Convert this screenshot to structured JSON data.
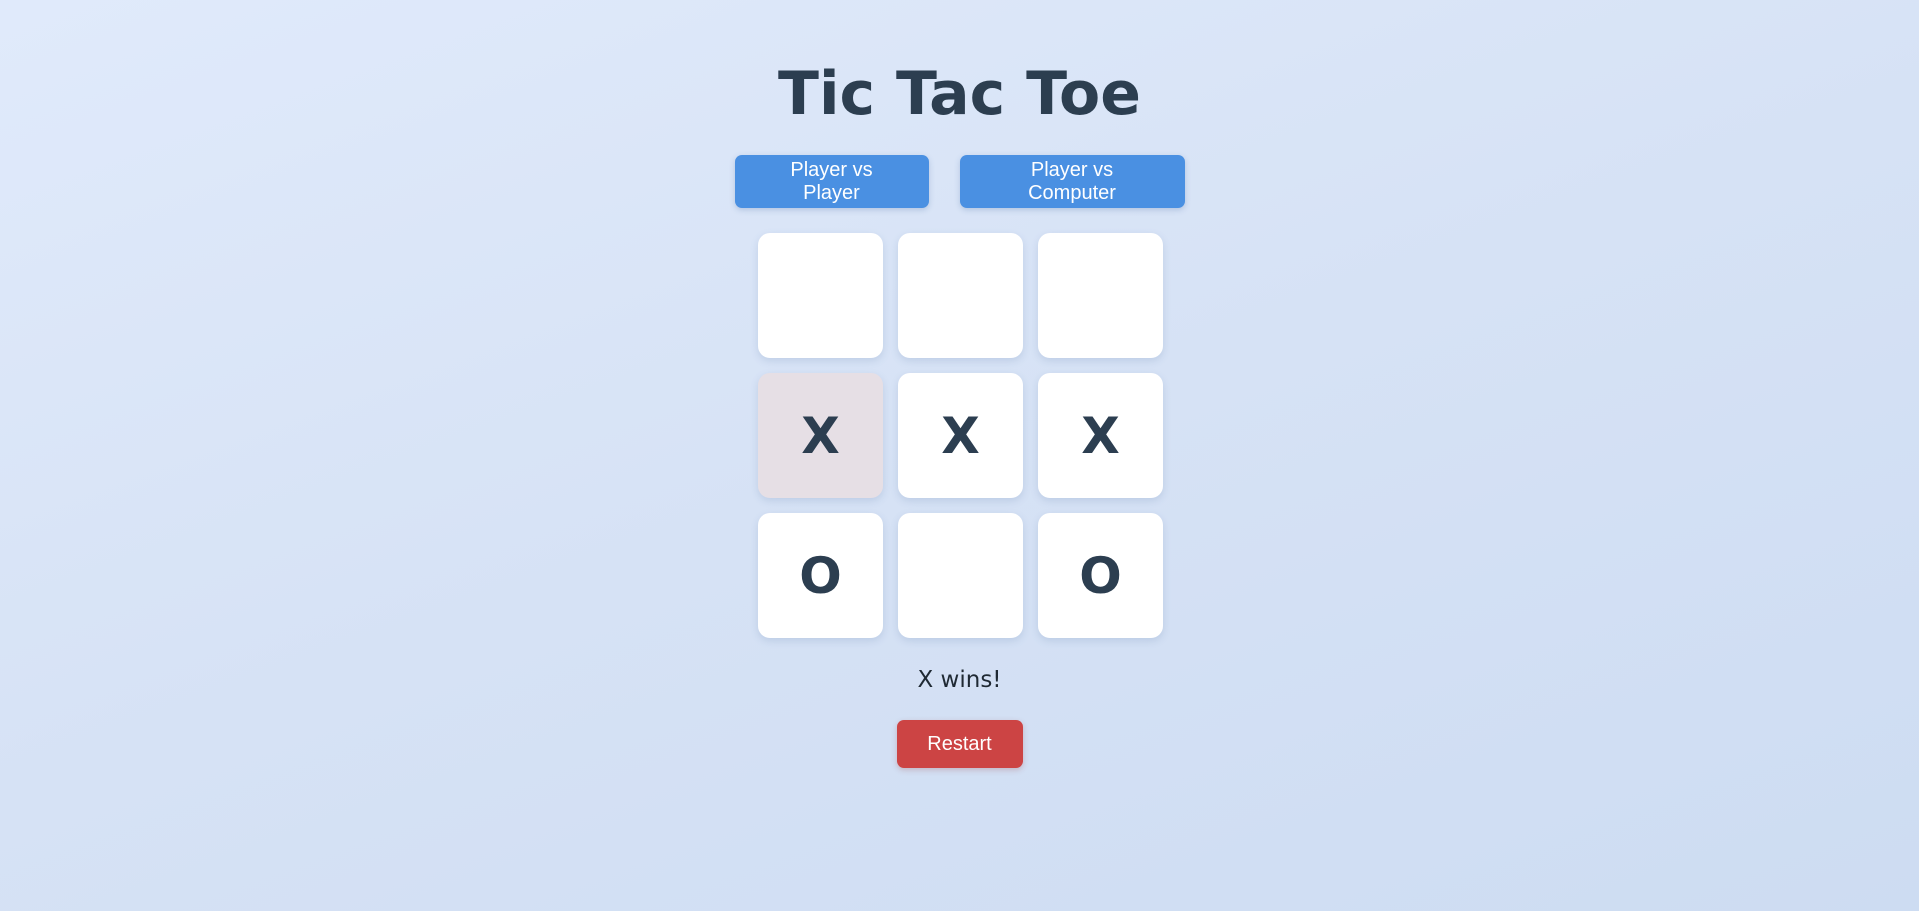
{
  "title": "Tic Tac Toe",
  "modes": {
    "pvp_label": "Player vs Player",
    "pvc_label": "Player vs Computer"
  },
  "board": {
    "cells": [
      "",
      "",
      "",
      "X",
      "X",
      "X",
      "O",
      "",
      "O"
    ],
    "highlighted_cell": 3
  },
  "status": "X wins!",
  "restart_label": "Restart",
  "colors": {
    "mode_button": "#4a90e2",
    "restart_button": "#cc4444",
    "mark": "#2c3e50",
    "highlight_cell": "#e6dfe5"
  }
}
